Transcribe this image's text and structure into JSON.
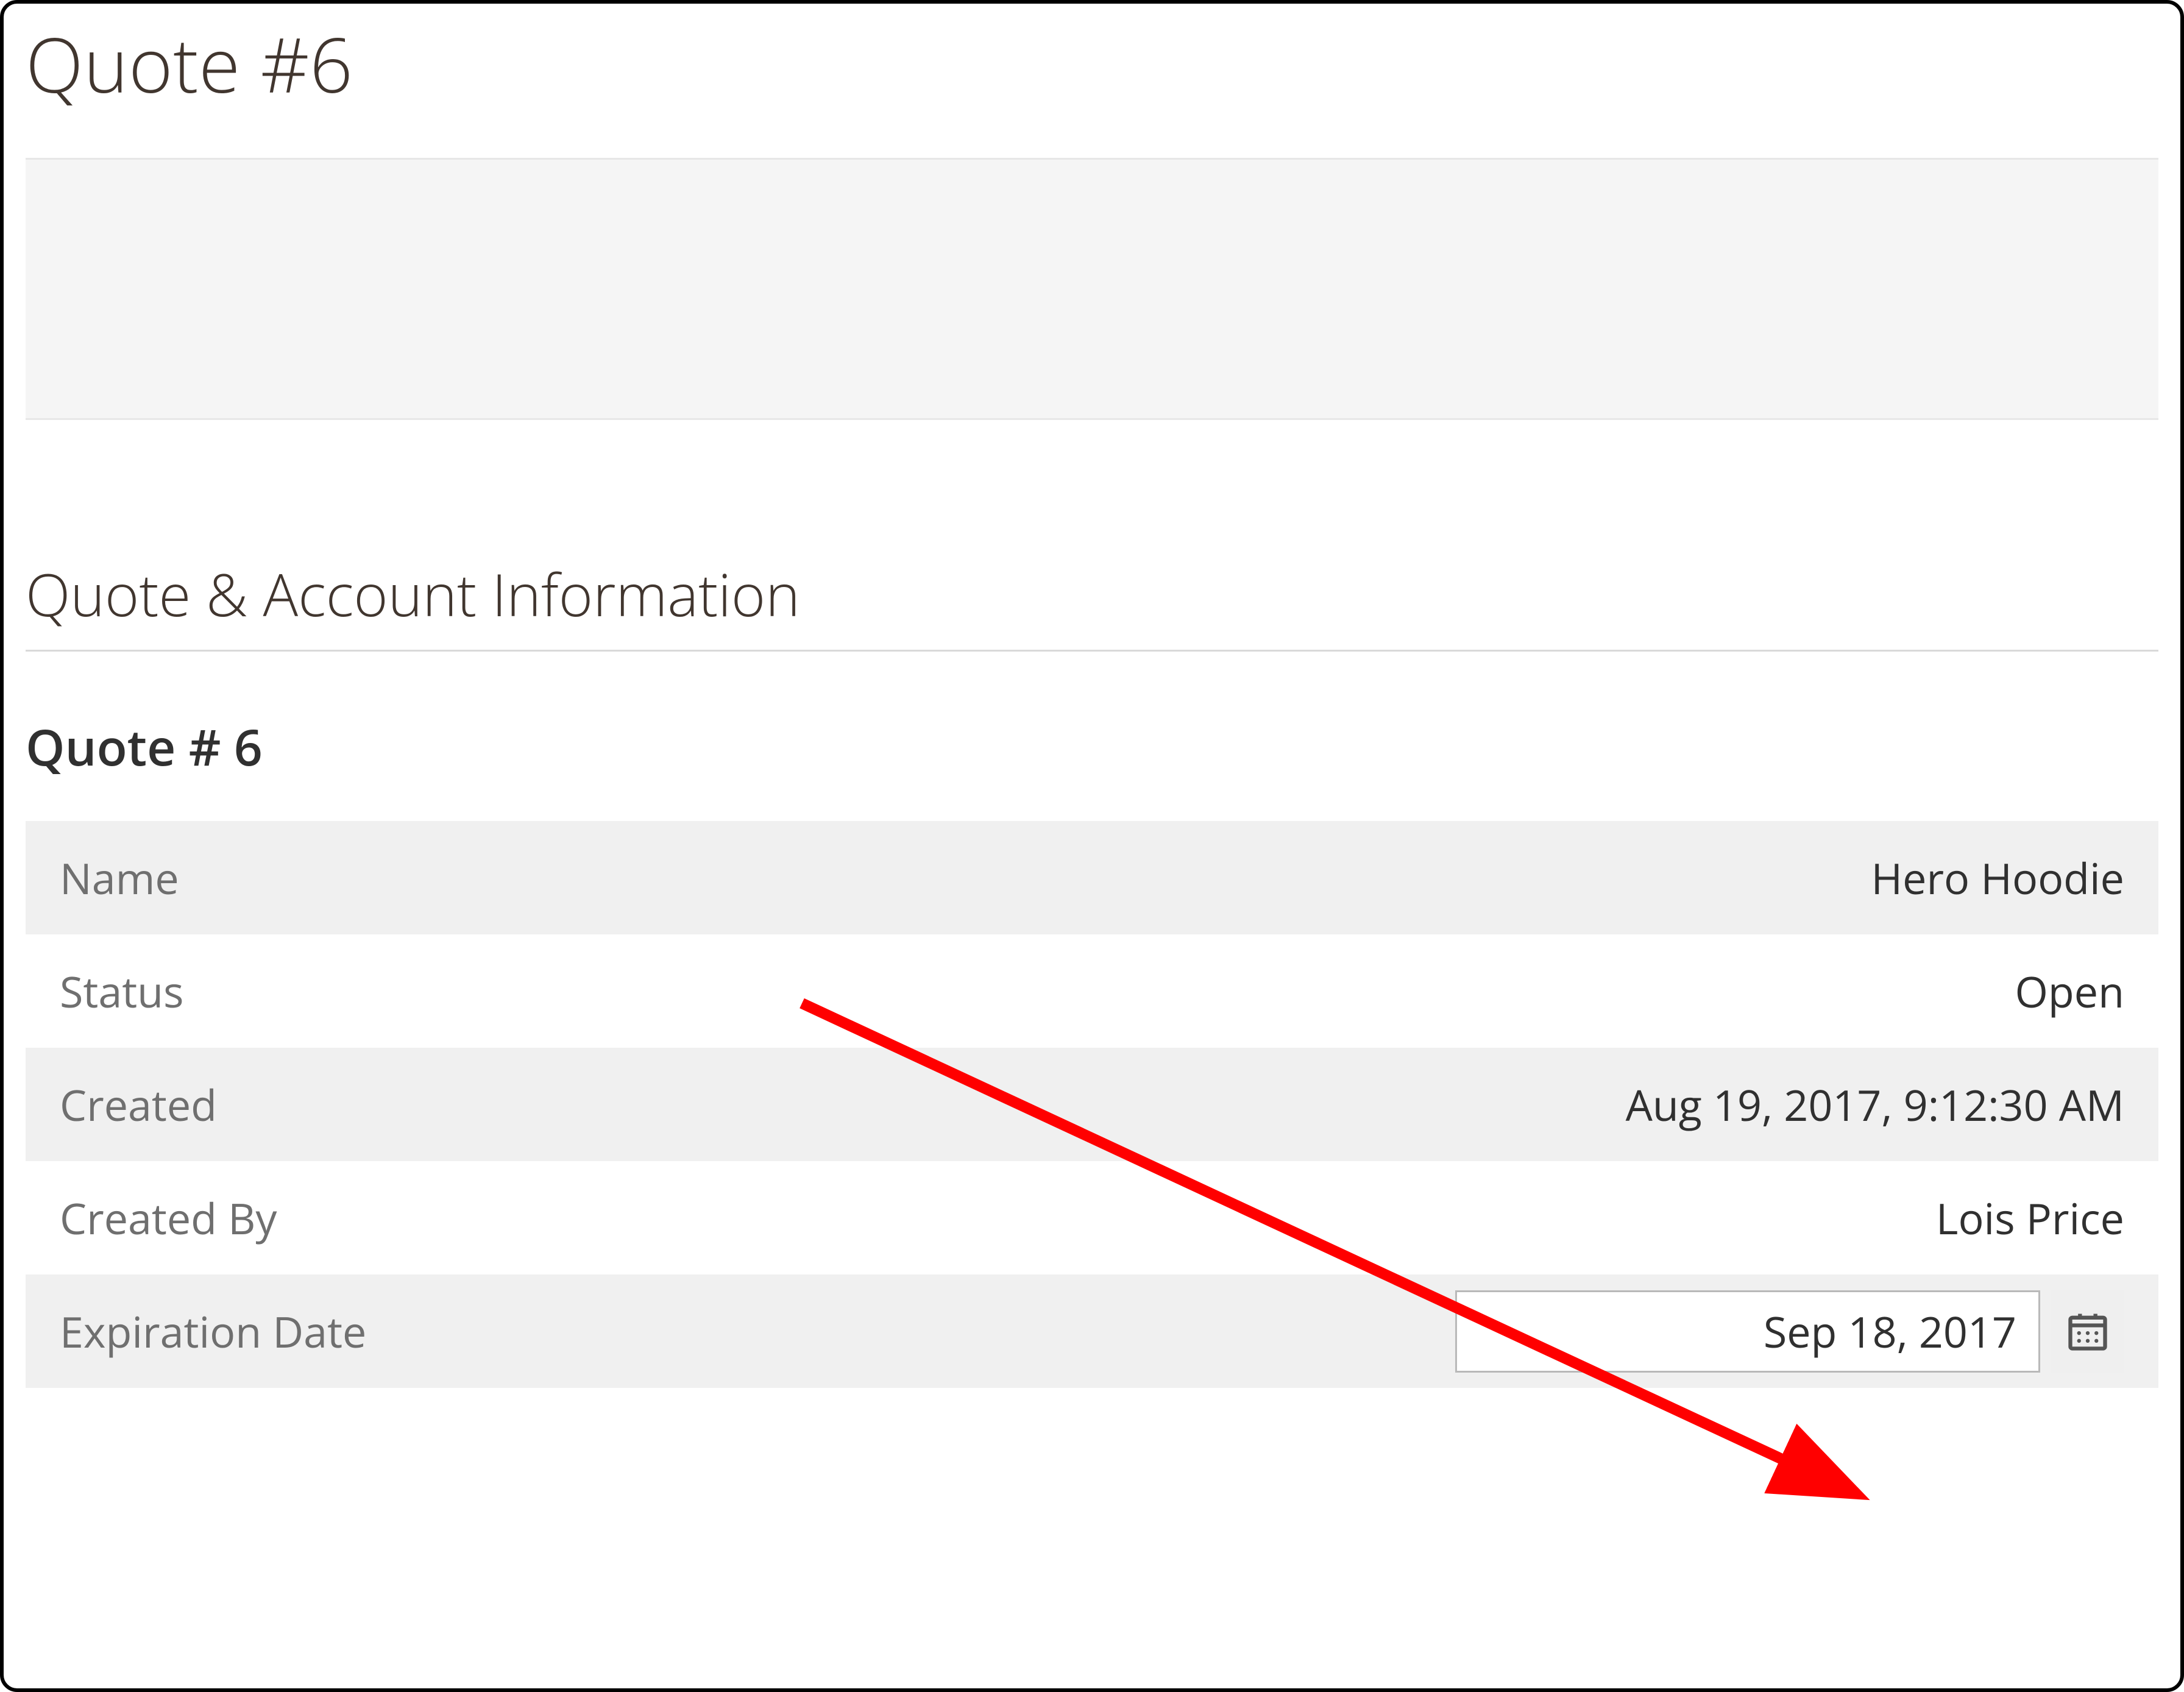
{
  "page": {
    "title": "Quote #6"
  },
  "section": {
    "heading": "Quote & Account Information",
    "subheading": "Quote # 6"
  },
  "rows": {
    "name": {
      "label": "Name",
      "value": "Hero Hoodie"
    },
    "status": {
      "label": "Status",
      "value": "Open"
    },
    "created": {
      "label": "Created",
      "value": "Aug 19, 2017, 9:12:30 AM"
    },
    "created_by": {
      "label": "Created By",
      "value": "Lois Price"
    },
    "expiration": {
      "label": "Expiration Date",
      "value": "Sep 18, 2017"
    }
  },
  "annotation": {
    "arrow_color": "#ff0000"
  }
}
